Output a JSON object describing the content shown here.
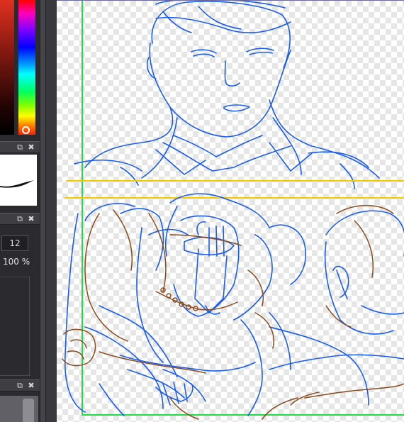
{
  "panels": {
    "brush": {
      "float_icon": "detach-icon",
      "close_icon": "close-icon"
    },
    "tool_settings": {
      "size_value": "12",
      "opacity_value": "100 %",
      "float_icon": "detach-icon",
      "close_icon": "close-icon"
    },
    "layers": {
      "float_icon": "detach-icon",
      "close_icon": "close-icon"
    }
  },
  "colors": {
    "sketch_blue": "#1a5cf0",
    "sketch_brown": "#8a4a1c",
    "guide_yellow": "#f5c800",
    "frame_green": "#22dd44"
  }
}
